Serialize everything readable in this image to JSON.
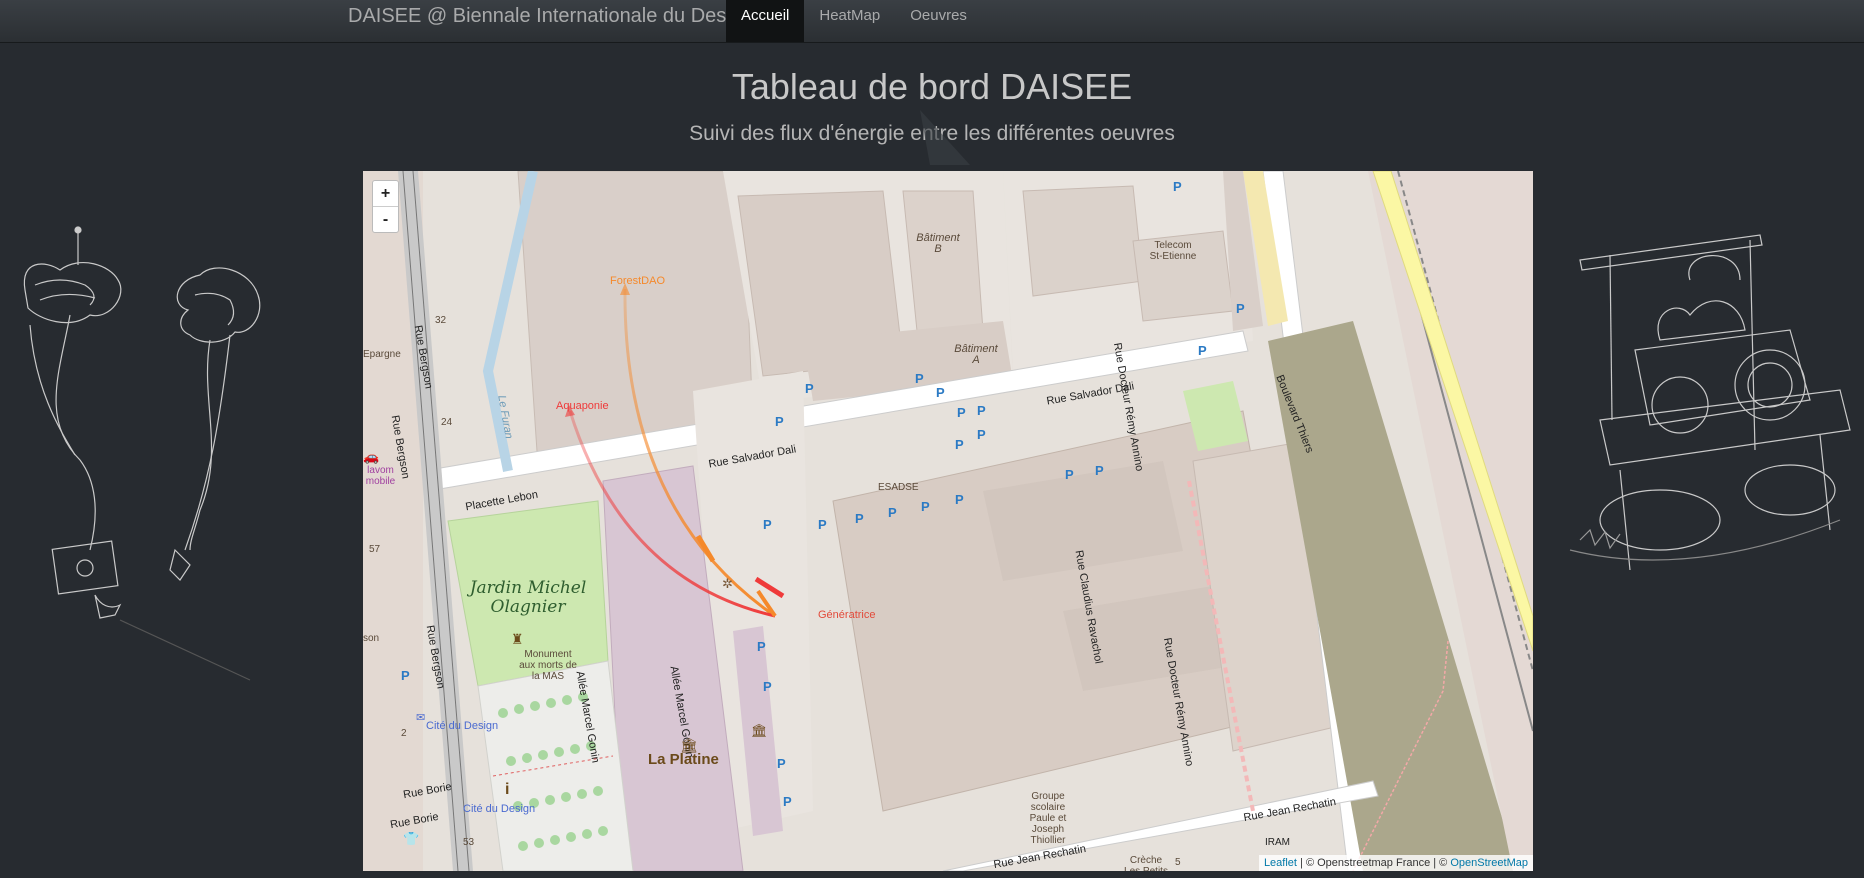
{
  "navbar": {
    "brand": "DAISEE @ Biennale Internationale du Design",
    "items": [
      "Accueil",
      "HeatMap",
      "Oeuvres"
    ],
    "active": "Accueil"
  },
  "header": {
    "title": "Tableau de bord DAISEE",
    "subtitle": "Suivi des flux d'énergie entre les différentes oeuvres"
  },
  "map": {
    "zoom_in": "+",
    "zoom_out": "-",
    "attribution": {
      "leaflet": "Leaflet",
      "sep1": " | © Openstreetmap France | © ",
      "osm": "OpenStreetMap"
    },
    "nodes": {
      "forest": "ForestDAO",
      "aquaponie": "Aquaponie",
      "generatrice": "Génératrice"
    },
    "flow_colors": {
      "forest": "#f5892b",
      "aquaponie": "#ef3a3a"
    },
    "streets": {
      "salvador_dali_1": "Rue Salvador Dali",
      "salvador_dali_2": "Rue Salvador Dali",
      "placette_lebon": "Placette Lebon",
      "rue_bergson_1": "Rue Bergson",
      "rue_bergson_2": "Rue Bergson",
      "rue_bergson_3": "Rue Bergson",
      "docteur_remy_1": "Rue Docteur Rémy Annino",
      "docteur_remy_2": "Rue Docteur Rémy Annino",
      "boulevard_thiers": "Boulevard Thiers",
      "claudius": "Rue Claudius Ravachol",
      "jean_rechatin_1": "Rue Jean Rechatin",
      "jean_rechatin_2": "Rue Jean Rechatin",
      "allee_gonin_1": "Allée Marcel Gonin",
      "allee_gonin_2": "Allée Marcel Gonin",
      "rue_borie_1": "Rue Borie",
      "rue_borie_2": "Rue Borie",
      "le_furan": "Le Furan"
    },
    "places": {
      "batiment_b": "Bâtiment B",
      "batiment_a": "Bâtiment A",
      "telecom": "Telecom St-Etienne",
      "esadse": "ESADSE",
      "jardin": "Jardin Michel Olagnier",
      "monument": "Monument aux morts de la MAS",
      "la_platine": "La Platine",
      "cite_design_1": "Cité du Design",
      "cite_design_2": "Cité du Design",
      "groupe_scolaire": "Groupe scolaire Paule et Joseph Thiollier",
      "creche": "Crèche Les Petits",
      "iram": "IRAM",
      "epargne": "Epargne",
      "lavom": "lavom mobile",
      "son": "son"
    },
    "numbers": [
      "32",
      "24",
      "57",
      "2",
      "53",
      "5"
    ],
    "icons": [
      "parking-icon",
      "bicycle-icon",
      "monument-icon",
      "info-icon",
      "museum-icon",
      "mail-icon"
    ]
  }
}
